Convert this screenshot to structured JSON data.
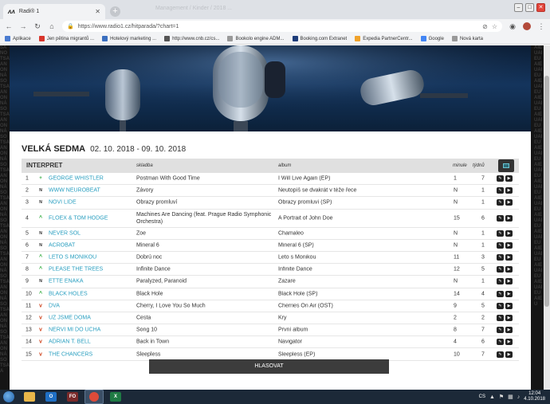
{
  "browser": {
    "tab_title": "Radi® 1",
    "faded_title": "Management / Kinder / 2018 ...",
    "url": "https://www.radio1.cz/hitparada/?chart=1",
    "bookmarks": [
      {
        "label": "Aplikace",
        "icon": "apps-icon",
        "color": "#4a7bd0"
      },
      {
        "label": "Jen pětina migrantů ...",
        "icon": "youtube-icon",
        "color": "#d8352b"
      },
      {
        "label": "Hotelový marketing ...",
        "icon": "w-icon",
        "color": "#3a6fbf"
      },
      {
        "label": "http://www.cnb.cz/cs...",
        "icon": "cnb-icon",
        "color": "#555555"
      },
      {
        "label": "Bookolo engine ADM...",
        "icon": "page-icon",
        "color": "#999999"
      },
      {
        "label": "Booking.com Extranet",
        "icon": "booking-icon",
        "color": "#1d3c7a"
      },
      {
        "label": "Expedia PartnerCentr...",
        "icon": "expedia-icon",
        "color": "#f0a22a"
      },
      {
        "label": "Google",
        "icon": "google-icon",
        "color": "#4285f4"
      },
      {
        "label": "Nová karta",
        "icon": "page-icon",
        "color": "#999999"
      }
    ]
  },
  "page": {
    "title": "VELKÁ SEDMA",
    "dates": "02. 10. 2018 - 09. 10. 2018",
    "headers": {
      "artist": "INTERPRET",
      "song": "skladba",
      "album": "album",
      "last": "minule",
      "weeks": "týdnů"
    },
    "vote_button": "HLASOVAT",
    "colors": {
      "link": "#2a9fc0",
      "up": "#2eaa3a",
      "down": "#d04a25",
      "header_bg": "#e0e0e0"
    }
  },
  "rows": [
    {
      "pos": "1",
      "trend": "same",
      "trend_symbol": "+",
      "artist": "GEORGE WHISTLER",
      "song": "Postman With Good Time",
      "album": "I Will Live Again (EP)",
      "last": "1",
      "weeks": "7"
    },
    {
      "pos": "2",
      "trend": "new",
      "trend_symbol": "N",
      "artist": "WWW NEUROBEAT",
      "song": "Závory",
      "album": "Neutopíš se dvakrát v téže řece",
      "last": "N",
      "weeks": "1"
    },
    {
      "pos": "3",
      "trend": "new",
      "trend_symbol": "N",
      "artist": "NOVÍ LIDÉ",
      "song": "Obrazy promluví",
      "album": "Obrazy promluví (SP)",
      "last": "N",
      "weeks": "1"
    },
    {
      "pos": "4",
      "trend": "up",
      "trend_symbol": "^",
      "artist": "FLOEX & TOM HODGE",
      "song": "Machines Are Dancing (feat. Prague Radio Symphonic Orchestra)",
      "album": "A Portrait of John Doe",
      "last": "15",
      "weeks": "6",
      "tall": true
    },
    {
      "pos": "5",
      "trend": "new",
      "trend_symbol": "N",
      "artist": "NEVER SOL",
      "song": "Zoe",
      "album": "Chamaleo",
      "last": "N",
      "weeks": "1"
    },
    {
      "pos": "6",
      "trend": "new",
      "trend_symbol": "N",
      "artist": "ACROBAT",
      "song": "Mineral 6",
      "album": "Mineral 6 (SP)",
      "last": "N",
      "weeks": "1"
    },
    {
      "pos": "7",
      "trend": "up",
      "trend_symbol": "^",
      "artist": "LETO S MONIKOU",
      "song": "Dobrú noc",
      "album": "Leto s Monikou",
      "last": "11",
      "weeks": "3"
    },
    {
      "pos": "8",
      "trend": "up",
      "trend_symbol": "^",
      "artist": "PLEASE THE TREES",
      "song": "Infinite Dance",
      "album": "Infinite Dance",
      "last": "12",
      "weeks": "5"
    },
    {
      "pos": "9",
      "trend": "new",
      "trend_symbol": "N",
      "artist": "ETTE ENAKA",
      "song": "Paralyzed, Paranoid",
      "album": "Zazare",
      "last": "N",
      "weeks": "1"
    },
    {
      "pos": "10",
      "trend": "up",
      "trend_symbol": "^",
      "artist": "BLACK HOLES",
      "song": "Black Hole",
      "album": "Black Hole (SP)",
      "last": "14",
      "weeks": "4"
    },
    {
      "pos": "11",
      "trend": "down",
      "trend_symbol": "v",
      "artist": "DVA",
      "song": "Cherry, I Love You So Much",
      "album": "Cherries On Air (OST)",
      "last": "9",
      "weeks": "5"
    },
    {
      "pos": "12",
      "trend": "down",
      "trend_symbol": "v",
      "artist": "UŽ JSME DOMA",
      "song": "Cesta",
      "album": "Kry",
      "last": "2",
      "weeks": "2"
    },
    {
      "pos": "13",
      "trend": "down",
      "trend_symbol": "v",
      "artist": "NEŘVI MI DO UCHA",
      "song": "Song 10",
      "album": "První album",
      "last": "8",
      "weeks": "7"
    },
    {
      "pos": "14",
      "trend": "down",
      "trend_symbol": "v",
      "artist": "ADRIAN T. BELL",
      "song": "Back in Town",
      "album": "Navigator",
      "last": "4",
      "weeks": "6"
    },
    {
      "pos": "15",
      "trend": "down",
      "trend_symbol": "v",
      "artist": "THE CHANCERS",
      "song": "Sleepless",
      "album": "Sleepless (EP)",
      "last": "10",
      "weeks": "7"
    }
  ],
  "taskbar": {
    "lang": "CS",
    "time": "12:04",
    "date": "4.10.2018",
    "apps": [
      {
        "name": "explorer-icon",
        "label": "",
        "color": "#e8b64a"
      },
      {
        "name": "outlook-icon",
        "label": "O",
        "color": "#1f6fc4"
      },
      {
        "name": "fo-icon",
        "label": "FO",
        "color": "#7a2a2a"
      },
      {
        "name": "chrome-icon",
        "label": "",
        "color": "#dd4b39"
      },
      {
        "name": "excel-icon",
        "label": "X",
        "color": "#1f7a44"
      }
    ]
  }
}
